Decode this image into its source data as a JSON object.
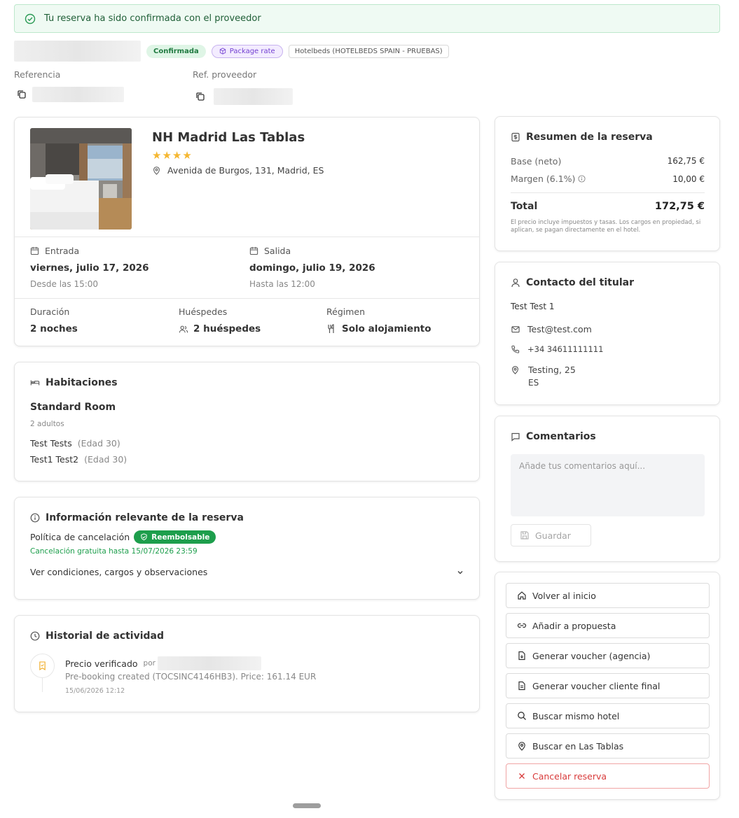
{
  "banner": {
    "text": "Tu reserva ha sido confirmada con el proveedor"
  },
  "header": {
    "status": "Confirmada",
    "rate": "Package rate",
    "provider": "Hotelbeds (HOTELBEDS SPAIN - PRUEBAS)",
    "ref_label": "Referencia",
    "prov_ref_label": "Ref. proveedor"
  },
  "hotel": {
    "name": "NH Madrid Las Tablas",
    "stars": 4,
    "address": "Avenida de Burgos, 131, Madrid, ES",
    "checkin_label": "Entrada",
    "checkin_date": "viernes, julio 17, 2026",
    "checkin_time": "Desde las 15:00",
    "checkout_label": "Salida",
    "checkout_date": "domingo, julio 19, 2026",
    "checkout_time": "Hasta las 12:00",
    "duration_label": "Duración",
    "duration": "2 noches",
    "guests_label": "Huéspedes",
    "guests": "2 huéspedes",
    "board_label": "Régimen",
    "board": "Solo alojamiento"
  },
  "rooms": {
    "title": "Habitaciones",
    "room_name": "Standard Room",
    "occupancy": "2 adultos",
    "guests": [
      {
        "name": "Test Tests",
        "age": "(Edad 30)"
      },
      {
        "name": "Test1 Test2",
        "age": "(Edad 30)"
      }
    ]
  },
  "info": {
    "title": "Información relevante de la reserva",
    "policy_label": "Política de cancelación",
    "policy_badge": "Reembolsable",
    "free_cancel": "Cancelación gratuita hasta 15/07/2026 23:59",
    "conditions": "Ver condiciones, cargos y observaciones"
  },
  "history": {
    "title": "Historial de actividad",
    "event_title": "Precio verificado",
    "by": "por",
    "event_desc": "Pre-booking created (TOCSINC4146HB3). Price: 161.14 EUR",
    "event_time": "15/06/2026 12:12"
  },
  "summary": {
    "title": "Resumen de la reserva",
    "base_label": "Base (neto)",
    "base_value": "162,75 €",
    "margin_label": "Margen (6.1%)",
    "margin_value": "10,00 €",
    "total_label": "Total",
    "total_value": "172,75 €",
    "note": "El precio incluye impuestos y tasas. Los cargos en propiedad, si aplican, se pagan directamente en el hotel."
  },
  "contact": {
    "title": "Contacto del titular",
    "name": "Test Test 1",
    "email": "Test@test.com",
    "phone": "+34 34611111111",
    "address_line1": "Testing, 25",
    "address_line2": "ES"
  },
  "comments": {
    "title": "Comentarios",
    "placeholder": "Añade tus comentarios aquí...",
    "save": "Guardar"
  },
  "actions": {
    "home": "Volver al inicio",
    "proposal": "Añadir a propuesta",
    "voucher_agency": "Generar voucher (agencia)",
    "voucher_client": "Generar voucher cliente final",
    "search_hotel": "Buscar mismo hotel",
    "search_area": "Buscar en Las Tablas",
    "cancel": "Cancelar reserva"
  },
  "colors": {
    "success": "#1d9e4c",
    "danger": "#d83a3a",
    "star": "#f5b731",
    "purple": "#7340d1"
  }
}
